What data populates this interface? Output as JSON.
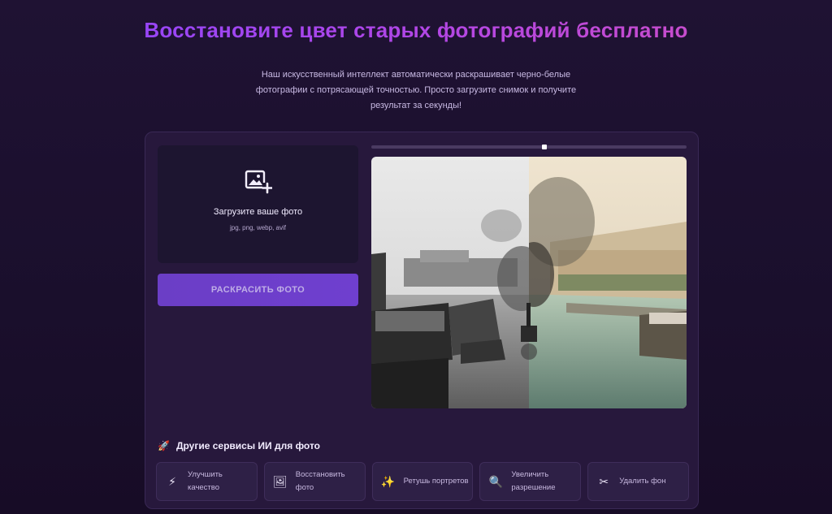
{
  "hero": {
    "title": "Восстановите цвет старых фотографий бесплатно",
    "subtitle_lines": [
      "Наш искусственный интеллект автоматически раскрашивает черно-белые",
      "фотографии с потрясающей точностью. Просто загрузите снимок и получите",
      "результат за секунды!"
    ]
  },
  "upload": {
    "icon": "image-plus-icon",
    "title": "Загрузите ваше фото",
    "formats": "jpg, png, webp, avif"
  },
  "actions": {
    "colorize_label": "РАСКРАСИТЬ ФОТО"
  },
  "compare": {
    "slider_position": 0.55
  },
  "services": {
    "title": "Другие сервисы ИИ для фото",
    "title_icon": "rocket-icon",
    "items": [
      {
        "icon": "lightning-icon",
        "label": "Улучшить качество"
      },
      {
        "icon": "picture-icon",
        "label": "Восстановить фото"
      },
      {
        "icon": "sparkles-icon",
        "label": "Ретушь портретов"
      },
      {
        "icon": "magnifier-icon",
        "label": "Увеличить разрешение"
      },
      {
        "icon": "scissors-icon",
        "label": "Удалить фон"
      }
    ]
  },
  "colors": {
    "accent": "#6b3ec6",
    "title_gradient_start": "#8b45ff",
    "title_gradient_end": "#d24fc0",
    "background": "#1f1233",
    "card": "#27183c"
  }
}
